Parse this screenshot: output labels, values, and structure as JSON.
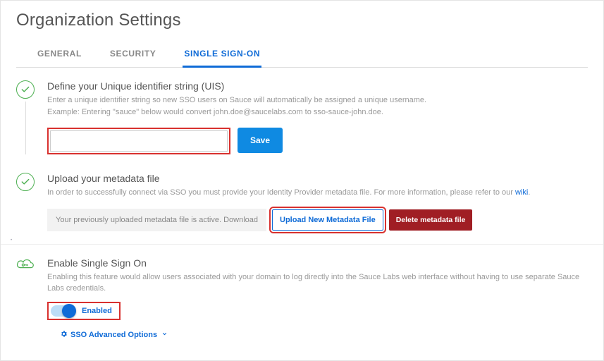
{
  "page_title": "Organization Settings",
  "tabs": {
    "general": "GENERAL",
    "security": "SECURITY",
    "sso": "SINGLE SIGN-ON"
  },
  "uis": {
    "title": "Define your Unique identifier string (UIS)",
    "desc1": "Enter a unique identifier string so new SSO users on Sauce will automatically be assigned a unique username.",
    "desc2": "Example: Entering \"sauce\" below would convert john.doe@saucelabs.com to sso-sauce-john.doe.",
    "input_value": "",
    "save_label": "Save"
  },
  "metadata": {
    "title": "Upload your metadata file",
    "desc": "In order to successfully connect via SSO you must provide your Identity Provider metadata file. For more information, please refer to our ",
    "wiki_label": "wiki",
    "status_prefix": "Your previously uploaded metadata file is active. ",
    "download_label": "Download",
    "upload_label": "Upload New Metadata File",
    "delete_label": "Delete metadata file"
  },
  "enable": {
    "title": "Enable Single Sign On",
    "desc": "Enabling this feature would allow users associated with your domain to log directly into the Sauce Labs web interface without having to use separate Sauce Labs credentials.",
    "toggle_label": "Enabled",
    "advanced_label": "SSO Advanced Options"
  }
}
